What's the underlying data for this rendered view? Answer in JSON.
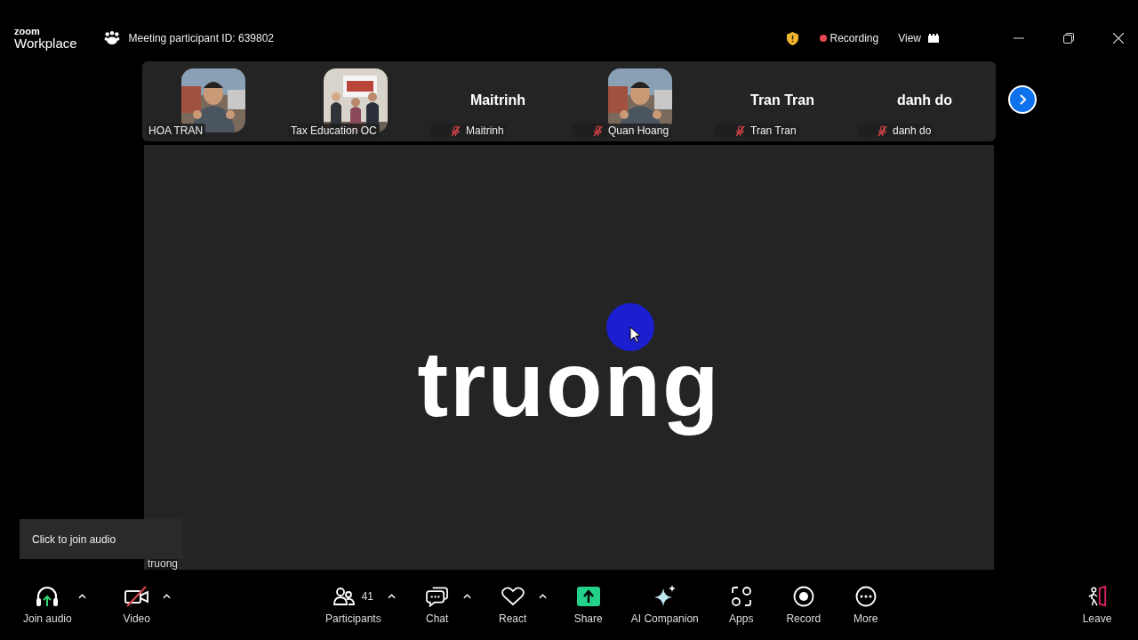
{
  "header": {
    "logo_top": "zoom",
    "logo_bottom": "Workplace",
    "meeting_id": "Meeting participant ID: 639802",
    "recording": "Recording",
    "view": "View"
  },
  "participants": [
    {
      "kind": "picture",
      "name": "HOA TRAN",
      "muted": false
    },
    {
      "kind": "picture",
      "name": "Tax Education OC",
      "muted": false
    },
    {
      "kind": "name",
      "title": "Maitrinh",
      "name": "Maitrinh",
      "muted": true
    },
    {
      "kind": "picture",
      "name": "Quan Hoang",
      "muted": true
    },
    {
      "kind": "name",
      "title": "Tran Tran",
      "name": "Tran Tran",
      "muted": true
    },
    {
      "kind": "name",
      "title": "danh do",
      "name": "danh do",
      "muted": true
    }
  ],
  "stage": {
    "name": "truong",
    "label": "truong"
  },
  "tooltip": "Click to join audio",
  "toolbar": [
    {
      "kind": "headphones",
      "label": "Join audio",
      "menu": true
    },
    {
      "kind": "video",
      "label": "Video",
      "menu": true,
      "off": true
    },
    {
      "kind": "people",
      "label": "Participants",
      "count": "41",
      "menu": true
    },
    {
      "kind": "chat",
      "label": "Chat",
      "menu": true
    },
    {
      "kind": "heart",
      "label": "React",
      "menu": true
    },
    {
      "kind": "share",
      "label": "Share",
      "menu": false
    },
    {
      "kind": "sparkle",
      "label": "AI Companion",
      "menu": false
    },
    {
      "kind": "apps",
      "label": "Apps",
      "menu": false
    },
    {
      "kind": "record",
      "label": "Record",
      "menu": false
    },
    {
      "kind": "more",
      "label": "More",
      "menu": false
    },
    {
      "kind": "leave",
      "label": "Leave",
      "menu": false
    }
  ]
}
